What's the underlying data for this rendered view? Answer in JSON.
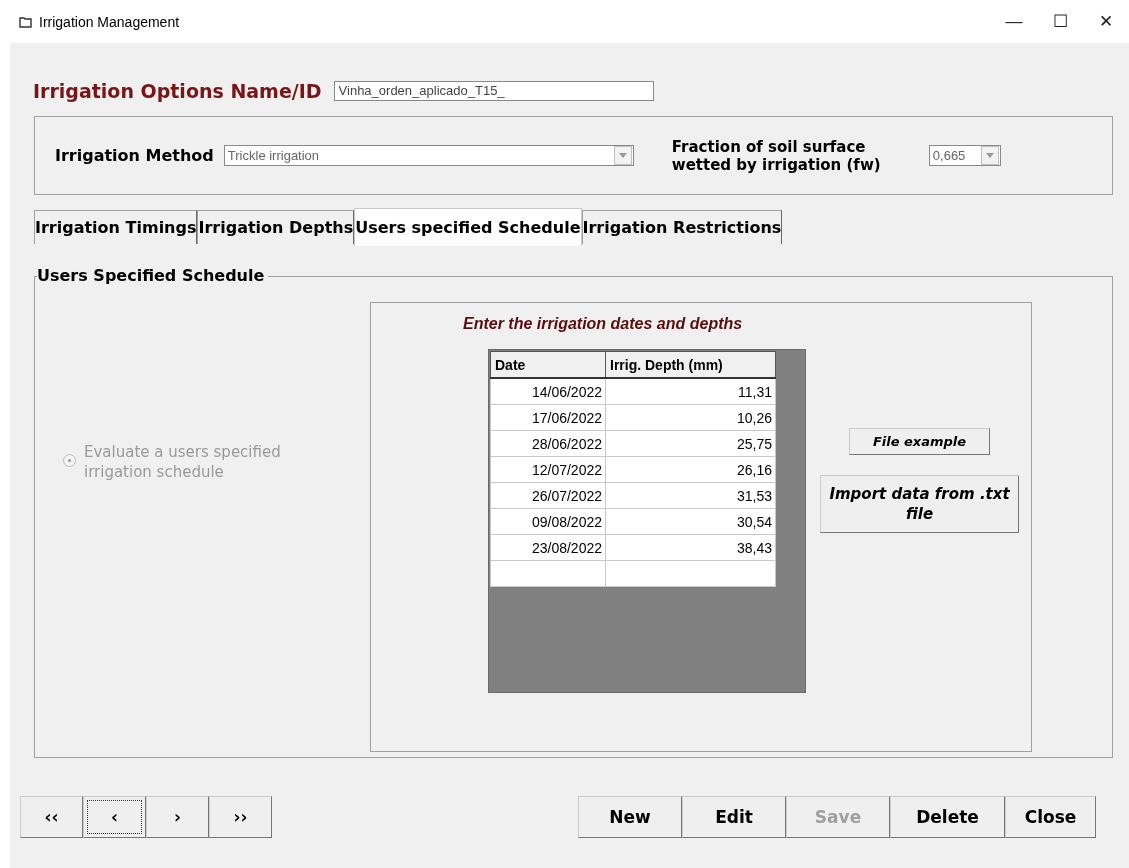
{
  "window": {
    "title": "Irrigation Management",
    "controls": [
      "—",
      "☐",
      "✕"
    ]
  },
  "options_name": {
    "label": "Irrigation Options Name/ID",
    "value": "Vinha_orden_aplicado_T15_"
  },
  "method": {
    "label": "Irrigation Method",
    "value": "Trickle irrigation",
    "fraction_label": "Fraction of soil surface wetted by irrigation (fw)",
    "fraction_value": "0,665"
  },
  "tabs": [
    {
      "label": "Irrigation Timings",
      "selected": false
    },
    {
      "label": "Irrigation Depths",
      "selected": false
    },
    {
      "label": "Users specified Schedule",
      "selected": true
    },
    {
      "label": "Irrigation Restrictions",
      "selected": false
    }
  ],
  "schedule": {
    "legend": "Users Specified Schedule",
    "radio": {
      "label": "Evaluate a users specified irrigation schedule",
      "selected": true,
      "disabled": true
    },
    "table_title": "Enter the irrigation dates and depths",
    "table": {
      "columns": [
        "Date",
        "Irrig. Depth (mm)"
      ],
      "rows": [
        [
          "14/06/2022",
          "11,31"
        ],
        [
          "17/06/2022",
          "10,26"
        ],
        [
          "28/06/2022",
          "25,75"
        ],
        [
          "12/07/2022",
          "26,16"
        ],
        [
          "26/07/2022",
          "31,53"
        ],
        [
          "09/08/2022",
          "30,54"
        ],
        [
          "23/08/2022",
          "38,43"
        ]
      ]
    },
    "file_example_button": "File example",
    "import_button": "Import data from .txt file"
  },
  "nav_buttons": [
    {
      "label": "‹‹",
      "focused": false
    },
    {
      "label": "‹",
      "focused": true
    },
    {
      "label": "›",
      "focused": false
    },
    {
      "label": "››",
      "focused": false
    }
  ],
  "action_buttons": [
    {
      "label": "New",
      "disabled": false
    },
    {
      "label": "Edit",
      "disabled": false
    },
    {
      "label": "Save",
      "disabled": true
    },
    {
      "label": "Delete",
      "disabled": false
    },
    {
      "label": "Close",
      "disabled": false
    }
  ]
}
